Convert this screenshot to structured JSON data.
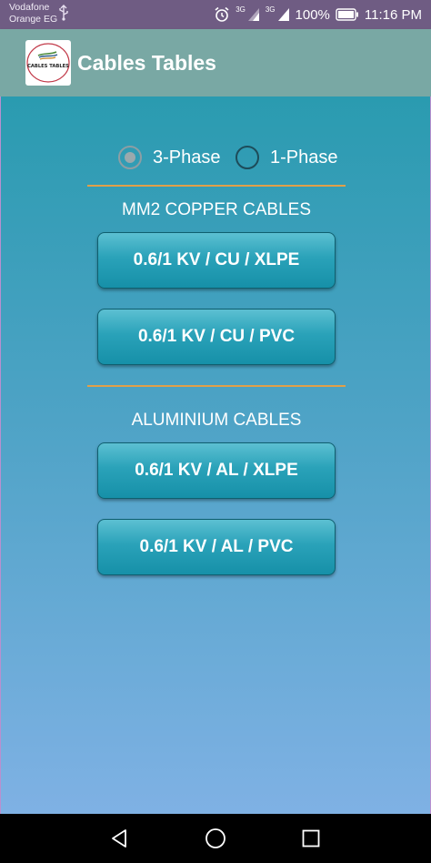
{
  "status_bar": {
    "carrier_line1": "Vodafone",
    "carrier_line2": "Orange EG",
    "network_1": "3G",
    "network_2": "3G",
    "battery": "100%",
    "time": "11:16 PM"
  },
  "app_bar": {
    "title": "Cables Tables",
    "logo_text": "CABLES TABLES"
  },
  "phase": {
    "options": [
      "3-Phase",
      "1-Phase"
    ],
    "selected": "3-Phase"
  },
  "sections": [
    {
      "title": "MM2 COPPER CABLES",
      "buttons": [
        "0.6/1 KV / CU / XLPE",
        "0.6/1 KV / CU / PVC"
      ]
    },
    {
      "title": "ALUMINIUM CABLES",
      "buttons": [
        "0.6/1 KV / AL / XLPE",
        "0.6/1 KV / AL / PVC"
      ]
    }
  ],
  "colors": {
    "status_bar": "#6f5c83",
    "app_bar": "#79a8a4",
    "divider": "#e1a049",
    "button": "#2aa2b9"
  },
  "icons": [
    "usb-icon",
    "alarm-icon",
    "signal-icon",
    "battery-icon",
    "back-icon",
    "home-icon",
    "recents-icon"
  ]
}
